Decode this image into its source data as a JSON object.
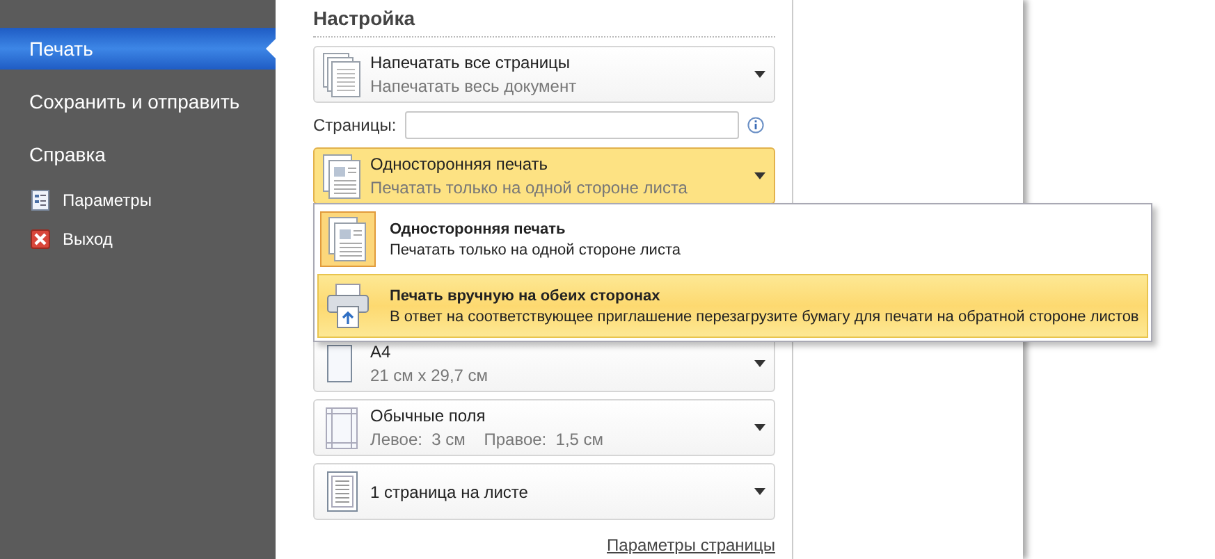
{
  "sidebar": {
    "items": [
      {
        "label": "Печать",
        "kind": "big",
        "selected": true
      },
      {
        "label": "Сохранить и отправить",
        "kind": "big",
        "selected": false
      },
      {
        "label": "Справка",
        "kind": "big",
        "selected": false
      },
      {
        "label": "Параметры",
        "kind": "small",
        "selected": false
      },
      {
        "label": "Выход",
        "kind": "small",
        "selected": false
      }
    ]
  },
  "settings": {
    "title": "Настройка",
    "rows": [
      {
        "kind": "dropdown",
        "title": "Напечатать все страницы",
        "subtitle": "Напечатать весь документ",
        "open": false
      },
      {
        "kind": "pages_field",
        "label": "Страницы:",
        "value": ""
      },
      {
        "kind": "dropdown",
        "title": "Односторонняя печать",
        "subtitle": "Печатать только на одной стороне листа",
        "open": true
      },
      {
        "kind": "dropdown",
        "title": "A4",
        "subtitle": "21 см x 29,7 см",
        "open": false
      },
      {
        "kind": "dropdown",
        "title": "Обычные поля",
        "subtitle": "Левое:  3 см    Правое:  1,5 см",
        "open": false
      },
      {
        "kind": "dropdown",
        "title": "1 страница на листе",
        "open": false
      }
    ],
    "link": "Параметры страницы"
  },
  "menu": {
    "items": [
      {
        "title": "Односторонняя печать",
        "subtitle": "Печатать только на одной стороне листа",
        "selected": true,
        "hovered": false
      },
      {
        "title": "Печать вручную на обеих сторонах",
        "subtitle": "В ответ на соответствующее приглашение перезагрузите бумагу для печати на обратной стороне листов",
        "selected": false,
        "hovered": true
      }
    ]
  }
}
